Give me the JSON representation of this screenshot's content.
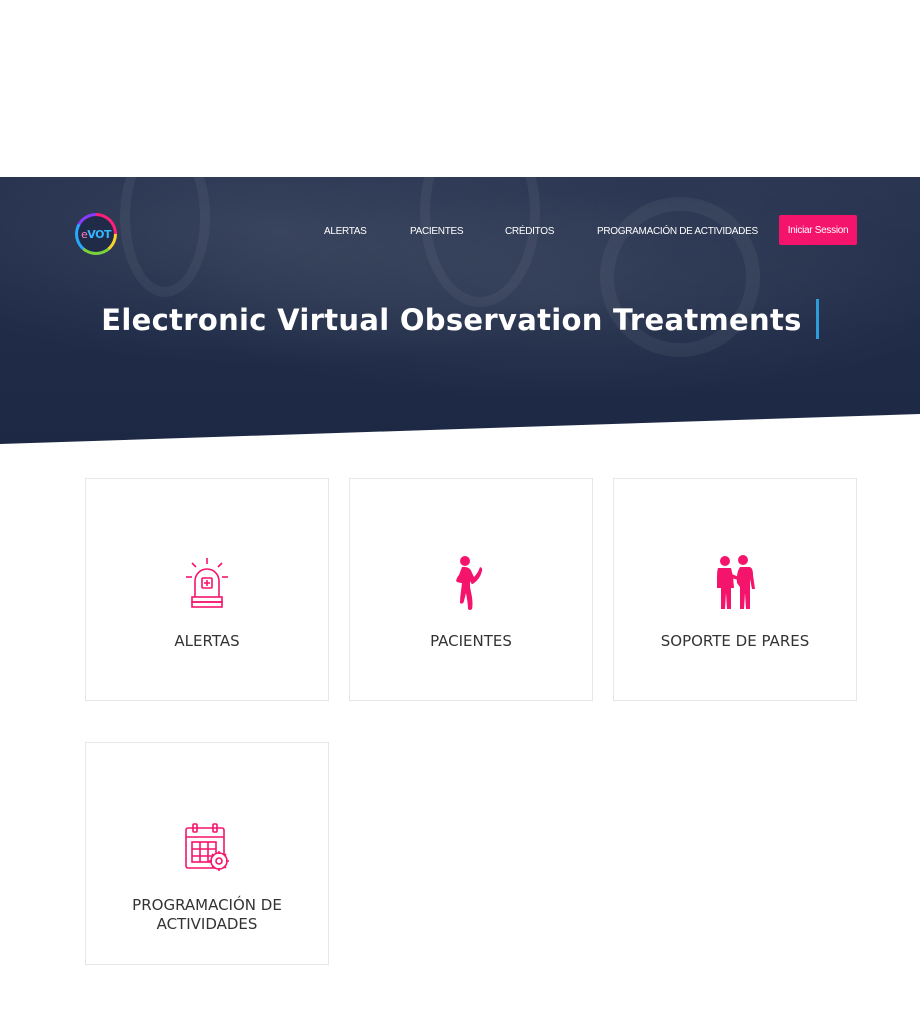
{
  "brand": {
    "logo_text": "VOT",
    "logo_prefix": "e",
    "accent": "#f5146c",
    "hero_bg": "#1f2b47"
  },
  "nav": {
    "items": [
      {
        "label": "ALERTAS"
      },
      {
        "label": "PACIENTES"
      },
      {
        "label": "CRÉDITOS"
      },
      {
        "label": "PROGRAMACIÓN DE ACTIVIDADES"
      }
    ],
    "login_label": "Iniciar Session"
  },
  "hero": {
    "title": "Electronic Virtual Observation Treatments"
  },
  "cards": [
    {
      "label": "ALERTAS",
      "icon": "siren-icon"
    },
    {
      "label": "PACIENTES",
      "icon": "patient-icon"
    },
    {
      "label": "SOPORTE DE PARES",
      "icon": "peer-support-icon"
    },
    {
      "label": "PROGRAMACIÓN DE ACTIVIDADES",
      "icon": "calendar-gear-icon"
    }
  ]
}
